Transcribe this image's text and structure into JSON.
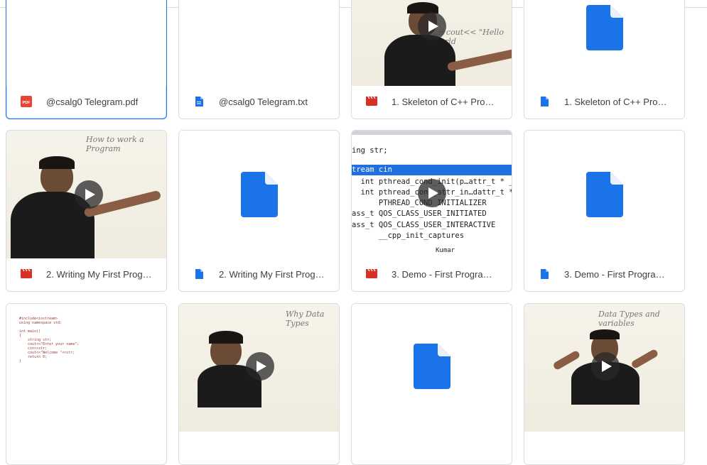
{
  "files": [
    {
      "name": "@csalg0 Telegram.pdf",
      "type": "pdf",
      "thumb": "blank",
      "selected": true
    },
    {
      "name": "@csalg0 Telegram.txt",
      "type": "doc",
      "thumb": "blank"
    },
    {
      "name": "1. Skeleton of C++ Progra...",
      "type": "video",
      "thumb": "lecture"
    },
    {
      "name": "1. Skeleton of C++ Progra...",
      "type": "doc",
      "thumb": "docicon"
    },
    {
      "name": "2. Writing My First Progra...",
      "type": "video",
      "thumb": "lecture"
    },
    {
      "name": "2. Writing My First Progra...",
      "type": "doc",
      "thumb": "docicon"
    },
    {
      "name": "3. Demo - First Program....",
      "type": "video",
      "thumb": "code"
    },
    {
      "name": "3. Demo - First Program.vtt",
      "type": "doc",
      "thumb": "docicon"
    },
    {
      "name": "",
      "type": "video",
      "thumb": "tinycode"
    },
    {
      "name": "",
      "type": "video",
      "thumb": "lecture"
    },
    {
      "name": "",
      "type": "doc",
      "thumb": "docicon"
    },
    {
      "name": "",
      "type": "video",
      "thumb": "lecture"
    }
  ],
  "thumb_text": {
    "board1": "..:: cout<< \"Hello world",
    "board2": "How to work a Program",
    "board3": "Why Data Types",
    "board4": "Data Types and variables",
    "code_line1": "ing str;",
    "code_hl": "tream cin",
    "code_items": [
      "  int pthread_cond_init(p…attr_t * _",
      "  int pthread_cond_attr_in…dattr_t *",
      "      PTHREAD_COND_INITIALIZER",
      "ass_t QOS_CLASS_USER_INITIATED",
      "ass_t QOS_CLASS_USER_INTERACTIVE",
      "      __cpp_init_captures"
    ],
    "code_tail": "Kumar",
    "tiny_code": "#include<iostream>\nusing namespace std;\n\nint main()\n{\n    string str;\n    cout<<\"Enter your name\";\n    cin>>str;\n    cout<<\"Welcome \"<<str;\n    return 0;\n}"
  },
  "colors": {
    "accent": "#1a73e8",
    "pdf": "#ea4335",
    "video": "#d93025",
    "doc": "#1a73e8",
    "border": "#dadce0"
  }
}
